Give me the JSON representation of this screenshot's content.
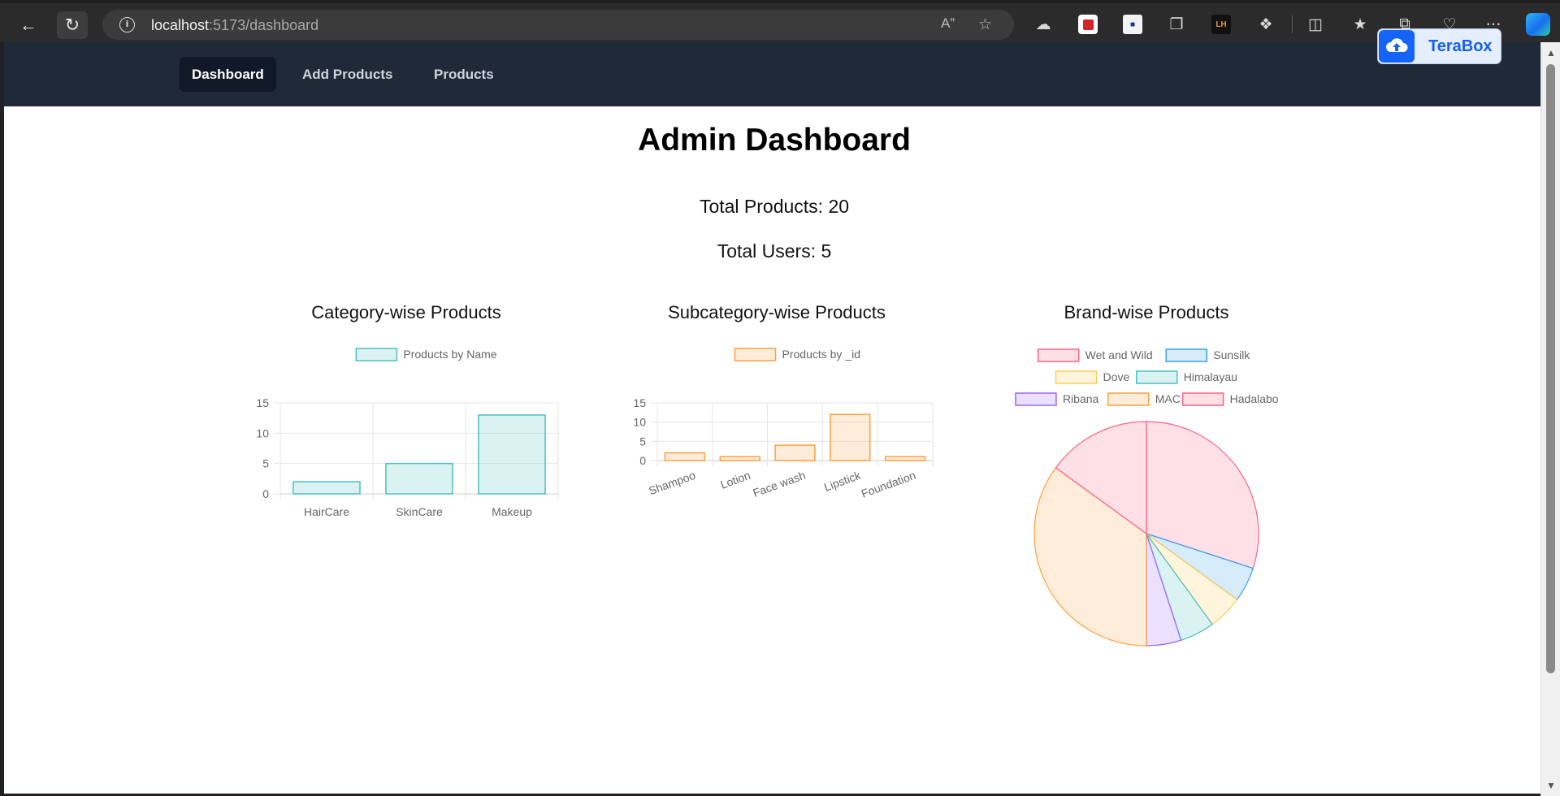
{
  "browser": {
    "url_host": "localhost",
    "url_rest": ":5173/dashboard",
    "icons": [
      "back-arrow-icon",
      "reload-icon",
      "info-icon",
      "read-aloud-icon",
      "favorite-star-icon",
      "cloud-extension-icon",
      "red-extension-icon",
      "flag-extension-icon",
      "document-extension-icon",
      "lh-extension-icon",
      "puzzle-extensions-icon",
      "split-screen-icon",
      "favorites-icon",
      "collections-icon",
      "health-icon",
      "more-icon",
      "copilot-icon"
    ]
  },
  "terabox": {
    "label": "TeraBox",
    "brand_color": "#1664f5"
  },
  "nav": {
    "items": [
      {
        "label": "Dashboard",
        "active": true
      },
      {
        "label": "Add Products",
        "active": false
      },
      {
        "label": "Products",
        "active": false
      }
    ]
  },
  "page": {
    "title": "Admin Dashboard",
    "total_products": "Total Products: 20",
    "total_users": "Total Users: 5"
  },
  "chart_data": [
    {
      "type": "bar",
      "title": "Category-wise Products",
      "legend": "Products by Name",
      "categories": [
        "HairCare",
        "SkinCare",
        "Makeup"
      ],
      "values": [
        2,
        5,
        13
      ],
      "yticks": [
        0,
        5,
        10,
        15
      ],
      "ylim": [
        0,
        15
      ],
      "color": "#4bc0c0",
      "fill": "rgba(75,192,192,0.2)"
    },
    {
      "type": "bar",
      "title": "Subcategory-wise Products",
      "legend": "Products by _id",
      "categories": [
        "Shampoo",
        "Lotion",
        "Face wash",
        "Lipstick",
        "Foundation"
      ],
      "values": [
        2,
        1,
        4,
        12,
        1
      ],
      "yticks": [
        0,
        5,
        10,
        15
      ],
      "ylim": [
        0,
        15
      ],
      "color": "#ff9f40",
      "fill": "rgba(255,159,64,0.2)"
    },
    {
      "type": "pie",
      "title": "Brand-wise Products",
      "labels": [
        "Wet and Wild",
        "Sunsilk",
        "Dove",
        "Himalayau",
        "Ribana",
        "MAC",
        "Hadalabo"
      ],
      "values": [
        6,
        1,
        1,
        1,
        1,
        7,
        3
      ],
      "colors": [
        "#ff6384",
        "#36a2eb",
        "#ffcd56",
        "#4bc0c0",
        "#9966ff",
        "#ff9f40",
        "#ff6384"
      ]
    }
  ]
}
